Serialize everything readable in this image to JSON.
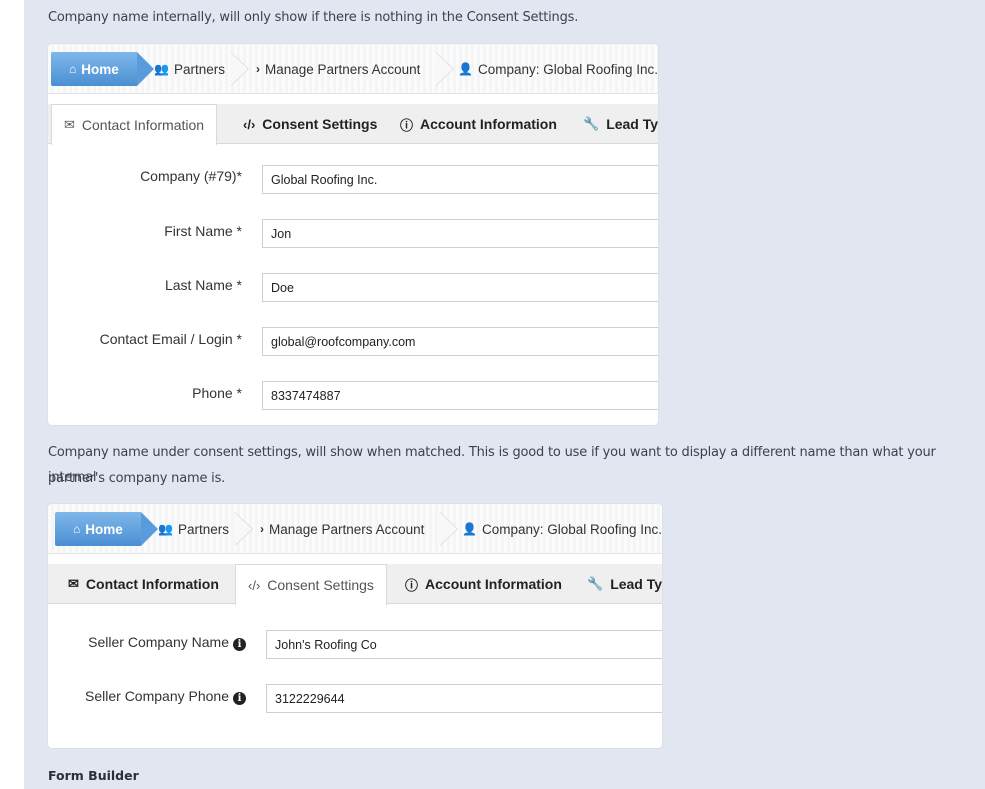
{
  "intro_text": "Company name internally, will only show if there is nothing in the Consent Settings.",
  "mid_text_line1": "Company name under consent settings, will show when matched. This is good to use if you want to display a different name than what your internal",
  "mid_text_line2": "partner's company name is.",
  "footer_heading": "Form Builder",
  "breadcrumb": {
    "home": "Home",
    "partners": "Partners",
    "manage": "Manage Partners Account",
    "company": "Company: Global Roofing Inc."
  },
  "tabs": {
    "contact": "Contact Information",
    "consent": "Consent Settings",
    "account": "Account Information",
    "lead": "Lead Typ"
  },
  "contact_form": {
    "company_label": "Company (#79)*",
    "company_value": "Global Roofing Inc.",
    "first_label": "First Name *",
    "first_value": "Jon",
    "last_label": "Last Name *",
    "last_value": "Doe",
    "email_label": "Contact Email / Login *",
    "email_value": "global@roofcompany.com",
    "phone_label": "Phone *",
    "phone_value": "8337474887"
  },
  "consent_form": {
    "seller_name_label": "Seller Company Name",
    "seller_name_value": "John's Roofing Co",
    "seller_phone_label": "Seller Company Phone",
    "seller_phone_value": "3122229644"
  },
  "icons": {
    "home": "home-icon",
    "partners": "users-icon",
    "manage": "chevron-right-icon",
    "company": "user-icon",
    "contact": "envelope-icon",
    "consent": "code-icon",
    "account": "info-circle-icon",
    "lead": "wrench-icon"
  },
  "colors": {
    "page_bg": "#e2e6f1",
    "home_crumb": "#5a9cdb"
  }
}
